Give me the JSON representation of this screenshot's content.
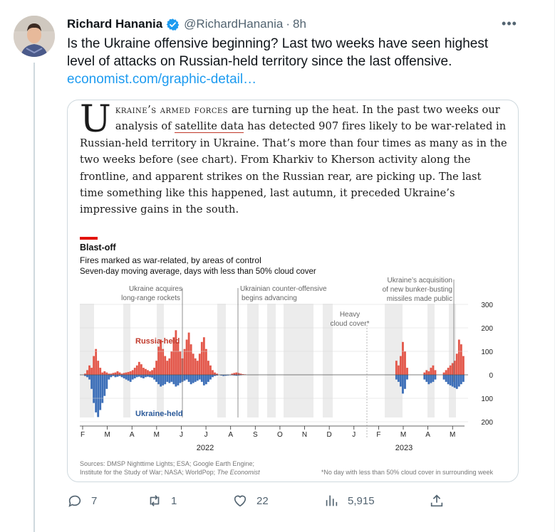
{
  "author": {
    "name": "Richard Hanania",
    "handle": "@RichardHanania",
    "time": "8h",
    "separator": "·"
  },
  "tweet": {
    "text": "Is the Ukraine offensive beginning? Last two weeks have seen highest level of attacks on Russian-held territory since the last offensive.",
    "link": "economist.com/graphic-detail…"
  },
  "article": {
    "dropcap": "U",
    "lead": "kraine’s armed forces",
    "rest1": " are turning up the heat. In the past two weeks our analysis of ",
    "link": "satellite data",
    "rest2": " has detected 907 fires likely to be war-related in Russian-held territory in Ukraine. That’s more than four times as many as in the two weeks before (see chart). From Kharkiv to Kherson activity along the frontline, and apparent strikes on the Russian rear, are picking up. The last time something like this happened, last autumn, it preceded Ukraine’s impressive gains in the south."
  },
  "chart_header": {
    "title": "Blast-off",
    "subtitle": "Fires marked as war-related, by areas of control",
    "subtitle2": "Seven-day moving average, days with less than 50% cloud cover",
    "annotation1_line1": "Ukraine acquires",
    "annotation1_line2": "long-range rockets",
    "annotation2_line1": "Ukrainian counter-offensive",
    "annotation2_line2": "begins advancing",
    "annotation3_line1": "Heavy",
    "annotation3_line2": "cloud cover*",
    "annotation4_line1": "Ukraine’s acquisition",
    "annotation4_line2": "of new bunker-busting",
    "annotation4_line3": "missiles made public",
    "series_russia": "Russia-held",
    "series_ukraine": "Ukraine-held",
    "year1": "2022",
    "year2": "2023",
    "sources_line1": "Sources: DMSP Nighttime Lights; ESA; Google Earth Engine;",
    "sources_line2": "Institute for the Study of War; NASA; WorldPop;",
    "sources_italic": "The Economist",
    "footnote": "*No day with less than 50% cloud cover in surrounding week"
  },
  "chart_data": {
    "type": "bar",
    "title": "Blast-off",
    "x_ticks": [
      "F",
      "M",
      "A",
      "M",
      "J",
      "J",
      "A",
      "S",
      "O",
      "N",
      "D",
      "J",
      "F",
      "M",
      "A",
      "M"
    ],
    "y_ticks_up": [
      "300",
      "200",
      "100",
      "0"
    ],
    "y_ticks_down": [
      "100",
      "200"
    ],
    "ylim": [
      -200,
      300
    ],
    "series": [
      {
        "name": "Russia-held",
        "color": "#e3584b",
        "values": [
          0,
          0,
          5,
          20,
          40,
          30,
          80,
          110,
          60,
          30,
          10,
          15,
          10,
          5,
          5,
          8,
          10,
          15,
          10,
          5,
          8,
          10,
          12,
          15,
          20,
          30,
          40,
          55,
          45,
          30,
          25,
          20,
          15,
          20,
          30,
          60,
          120,
          150,
          110,
          80,
          60,
          70,
          100,
          160,
          190,
          140,
          100,
          70,
          110,
          150,
          180,
          130,
          90,
          70,
          60,
          90,
          140,
          160,
          110,
          60,
          40,
          20,
          10,
          5,
          0,
          0,
          0,
          0,
          0,
          0,
          5,
          8,
          10,
          8,
          5,
          3,
          2,
          0,
          0,
          0,
          0,
          0,
          0,
          0,
          0,
          0,
          0,
          0,
          0,
          0,
          0,
          0,
          0,
          0,
          0,
          0,
          0,
          0,
          0,
          0,
          0,
          0,
          0,
          0,
          0,
          0,
          0,
          0,
          0,
          0,
          0,
          0,
          0,
          0,
          0,
          0,
          0,
          0,
          0,
          0,
          0,
          0,
          0,
          0,
          0,
          0,
          0,
          0,
          0,
          0,
          0,
          0,
          0,
          0,
          0,
          0,
          0,
          0,
          0,
          0,
          0,
          0,
          0,
          0,
          0,
          0,
          60,
          40,
          80,
          140,
          100,
          30,
          0,
          0,
          0,
          0,
          0,
          0,
          0,
          10,
          20,
          15,
          30,
          40,
          20,
          0,
          0,
          0,
          10,
          20,
          30,
          40,
          50,
          60,
          90,
          150,
          130,
          80
        ]
      },
      {
        "name": "Ukraine-held",
        "color": "#3d6fb8",
        "values": [
          0,
          0,
          -5,
          -10,
          -20,
          -60,
          -120,
          -160,
          -180,
          -150,
          -120,
          -90,
          -60,
          -20,
          -10,
          -5,
          -10,
          -8,
          -5,
          -10,
          -15,
          -20,
          -25,
          -30,
          -20,
          -15,
          -10,
          -8,
          -12,
          -15,
          -10,
          -8,
          -10,
          -12,
          -20,
          -30,
          -40,
          -50,
          -45,
          -40,
          -30,
          -35,
          -30,
          -40,
          -50,
          -45,
          -35,
          -30,
          -25,
          -20,
          -30,
          -40,
          -35,
          -30,
          -25,
          -20,
          -30,
          -45,
          -40,
          -30,
          -20,
          -10,
          -5,
          -3,
          0,
          -3,
          -5,
          -4,
          -3,
          -2,
          -2,
          -3,
          -4,
          -3,
          -2,
          0,
          0,
          0,
          0,
          0,
          0,
          0,
          0,
          0,
          0,
          0,
          0,
          0,
          0,
          0,
          0,
          0,
          0,
          0,
          0,
          0,
          0,
          0,
          0,
          0,
          0,
          0,
          0,
          0,
          0,
          0,
          0,
          0,
          0,
          0,
          0,
          0,
          0,
          0,
          0,
          0,
          0,
          0,
          0,
          0,
          0,
          0,
          0,
          0,
          0,
          0,
          0,
          0,
          0,
          0,
          0,
          0,
          0,
          0,
          0,
          0,
          0,
          0,
          0,
          0,
          0,
          0,
          0,
          0,
          0,
          0,
          -20,
          -30,
          -50,
          -80,
          -60,
          -20,
          0,
          0,
          0,
          0,
          0,
          0,
          0,
          -20,
          -30,
          -40,
          -35,
          -30,
          -20,
          0,
          0,
          0,
          -20,
          -30,
          -40,
          -45,
          -50,
          -55,
          -60,
          -50,
          -40,
          -30
        ]
      }
    ]
  },
  "actions": {
    "replies": "7",
    "retweets": "1",
    "likes": "22",
    "views": "5,915"
  },
  "colors": {
    "accent": "#1d9bf0",
    "muted": "#536471",
    "russia": "#e3584b",
    "ukraine": "#3d6fb8"
  }
}
